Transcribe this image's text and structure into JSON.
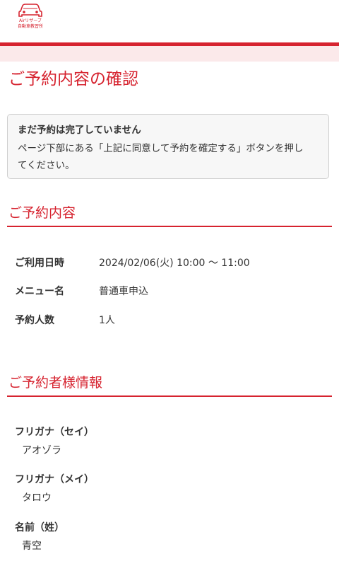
{
  "header": {
    "logo_line1": "Airリザーブ",
    "logo_line2": "自動車教習所"
  },
  "page_title": "ご予約内容の確認",
  "notice": {
    "title": "まだ予約は完了していません",
    "body_line1": "ページ下部にある「上記に同意して予約を確定する」ボタンを押し",
    "body_line2": "てください。"
  },
  "reservation": {
    "heading": "ご予約内容",
    "rows": [
      {
        "label": "ご利用日時",
        "value": "2024/02/06(火) 10:00 〜 11:00"
      },
      {
        "label": "メニュー名",
        "value": "普通車申込"
      },
      {
        "label": "予約人数",
        "value": "1人"
      }
    ]
  },
  "customer": {
    "heading": "ご予約者様情報",
    "fields": [
      {
        "label": "フリガナ（セイ）",
        "value": "アオゾラ"
      },
      {
        "label": "フリガナ（メイ）",
        "value": "タロウ"
      },
      {
        "label": "名前（姓）",
        "value": "青空"
      }
    ]
  },
  "colors": {
    "accent": "#d6232f",
    "band": "#fbe9ea",
    "notice_bg": "#f7f7f7"
  }
}
